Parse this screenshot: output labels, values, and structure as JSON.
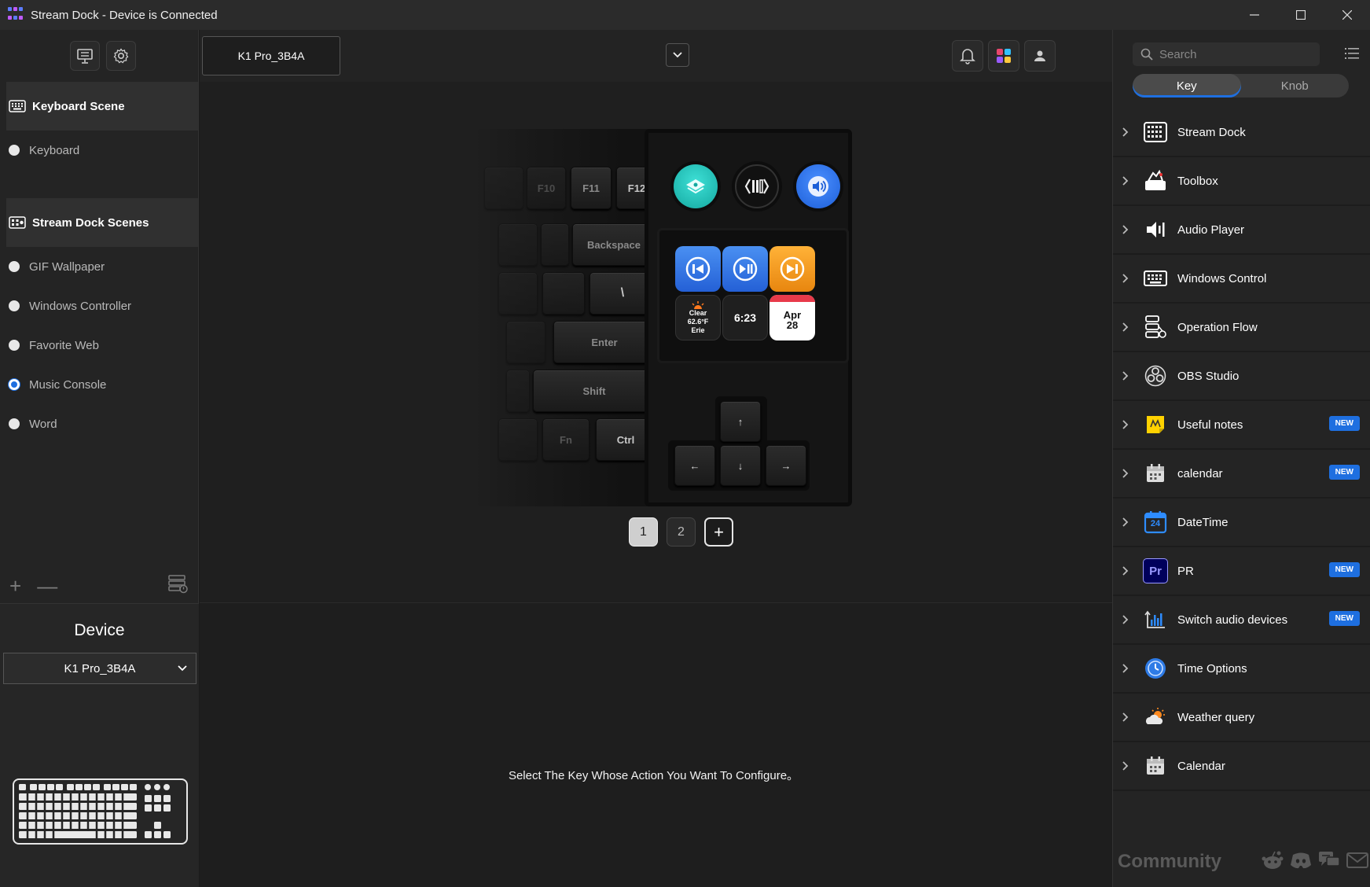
{
  "window": {
    "title": "Stream Dock - Device is Connected",
    "controls": [
      "minimize-icon",
      "maximize-icon",
      "close-icon"
    ]
  },
  "left": {
    "sections": [
      {
        "title": "Keyboard Scene",
        "icon": "keyboard-icon",
        "items": [
          {
            "label": "Keyboard",
            "selected": false
          }
        ]
      },
      {
        "title": "Stream Dock Scenes",
        "icon": "stream-dock-icon",
        "items": [
          {
            "label": "GIF Wallpaper",
            "selected": false
          },
          {
            "label": "Windows Controller",
            "selected": false
          },
          {
            "label": "Favorite Web",
            "selected": false
          },
          {
            "label": "Music Console",
            "selected": true
          },
          {
            "label": "Word",
            "selected": false
          }
        ]
      }
    ],
    "tools": {
      "add": "+",
      "remove": "—"
    },
    "device": {
      "title": "Device",
      "selected": "K1 Pro_3B4A"
    }
  },
  "center": {
    "device_tab": "K1 Pro_3B4A",
    "keys": {
      "f10": "F10",
      "f11": "F11",
      "f12": "F12",
      "backspace": "Backspace",
      "enter": "Enter",
      "shift": "Shift",
      "fn": "Fn",
      "ctrl": "Ctrl",
      "backslash": "\\",
      "up": "↑",
      "left": "←",
      "down": "↓",
      "right": "→"
    },
    "lcd": {
      "weather": {
        "line1": "Clear",
        "line2": "62.6°F",
        "line3": "Erie"
      },
      "clock": "6:23",
      "date": {
        "month": "Apr",
        "day": "28"
      }
    },
    "pages": [
      "1",
      "2"
    ],
    "current_page": "1",
    "add_page": "+",
    "hint": "Select The Key Whose Action You Want To Configure。"
  },
  "right": {
    "search_placeholder": "Search",
    "tabs": [
      "Key",
      "Knob"
    ],
    "active_tab": "Key",
    "plugins": [
      {
        "name": "Stream Dock",
        "icon": "stream-dock-grid-icon",
        "badge": ""
      },
      {
        "name": "Toolbox",
        "icon": "toolbox-icon",
        "badge": ""
      },
      {
        "name": "Audio Player",
        "icon": "speaker-icon",
        "badge": ""
      },
      {
        "name": "Windows Control",
        "icon": "keyboard-icon",
        "badge": ""
      },
      {
        "name": "Operation Flow",
        "icon": "flow-icon",
        "badge": ""
      },
      {
        "name": "OBS Studio",
        "icon": "obs-icon",
        "badge": ""
      },
      {
        "name": "Useful notes",
        "icon": "sticky-note-icon",
        "badge": "NEW"
      },
      {
        "name": "calendar",
        "icon": "calendar-icon",
        "badge": "NEW"
      },
      {
        "name": "DateTime",
        "icon": "datetime-icon",
        "badge": ""
      },
      {
        "name": "PR",
        "icon": "premiere-icon",
        "badge": "NEW"
      },
      {
        "name": "Switch audio devices",
        "icon": "audio-switch-icon",
        "badge": "NEW"
      },
      {
        "name": "Time Options",
        "icon": "clock-icon",
        "badge": ""
      },
      {
        "name": "Weather query",
        "icon": "weather-icon",
        "badge": ""
      },
      {
        "name": "Calendar",
        "icon": "calendar-icon",
        "badge": ""
      }
    ],
    "community": "Community",
    "social_icons": [
      "reddit-icon",
      "discord-icon",
      "chat-icon",
      "mail-icon"
    ]
  },
  "colors": {
    "accent": "#1e6fe0",
    "teal_knob": "#1ec8c0",
    "blue_knob": "#2a6fe8",
    "media_blue": "#2d7be6",
    "media_orange": "#f0a020",
    "calendar_red": "#e83a4a"
  },
  "pr_glyph": "Pr",
  "datetime_glyph": "24"
}
